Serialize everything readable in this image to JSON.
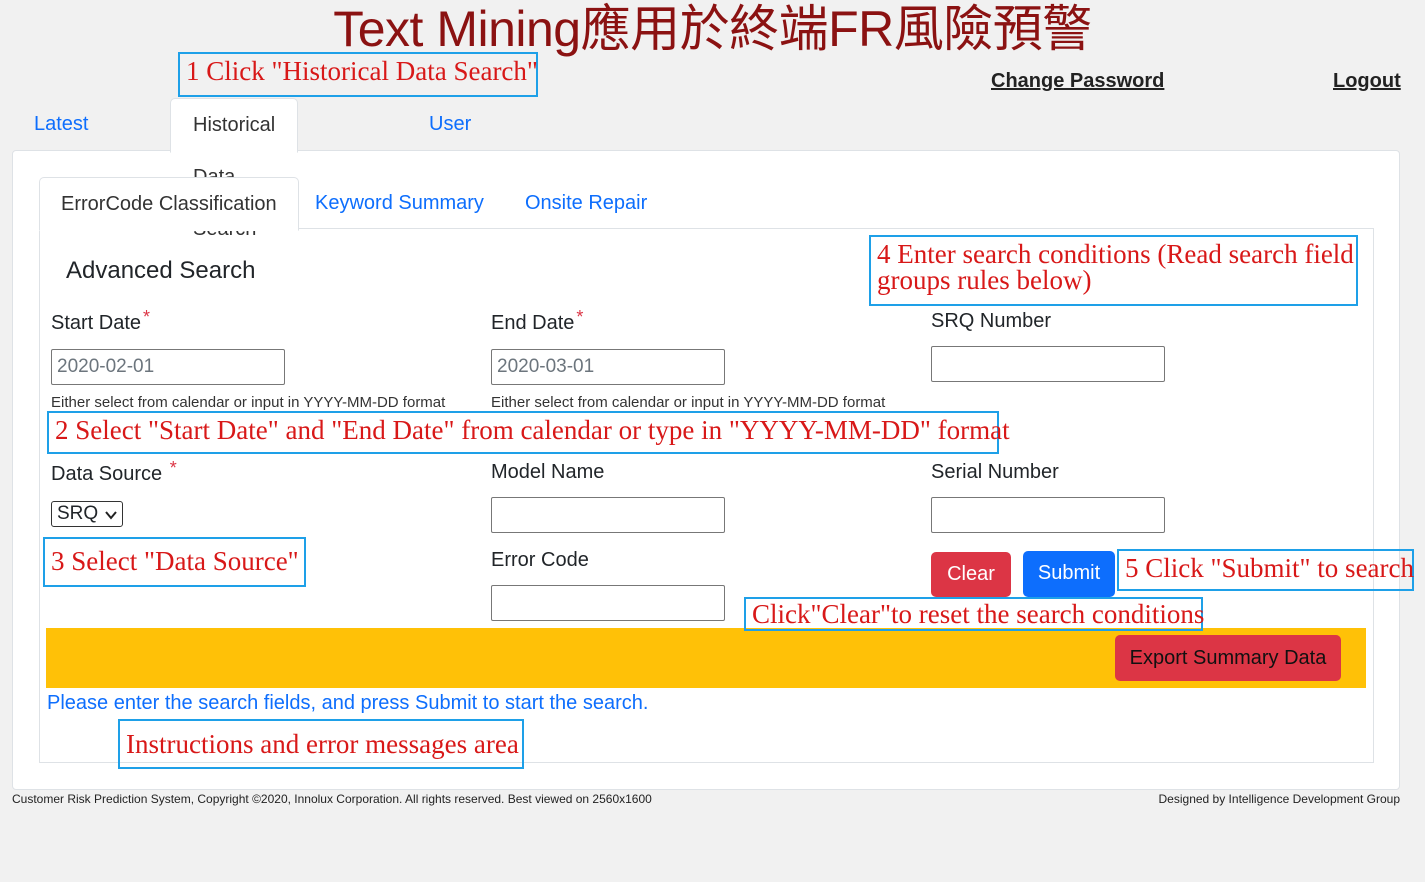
{
  "header": {
    "title": "Text Mining應用於終端FR風險預警",
    "change_password": "Change Password",
    "logout": "Logout"
  },
  "main_tabs": [
    {
      "label": "Latest Model",
      "active": false
    },
    {
      "label": "Historical Data Search",
      "active": true
    },
    {
      "label": "User Manual",
      "active": false
    }
  ],
  "sub_tabs": [
    {
      "label": "ErrorCode Classification",
      "active": true
    },
    {
      "label": "Keyword Summary",
      "active": false
    },
    {
      "label": "Onsite Repair",
      "active": false
    }
  ],
  "form": {
    "heading": "Advanced Search",
    "start_date": {
      "label": "Start Date",
      "value": "2020-02-01",
      "hint": "Either select from calendar or input in YYYY-MM-DD format"
    },
    "end_date": {
      "label": "End Date",
      "value": "2020-03-01",
      "hint": "Either select from calendar or input in YYYY-MM-DD format"
    },
    "srq_number": {
      "label": "SRQ Number",
      "value": ""
    },
    "data_source": {
      "label": "Data Source",
      "value": "SRQ"
    },
    "model_name": {
      "label": "Model Name",
      "value": ""
    },
    "serial_number": {
      "label": "Serial Number",
      "value": ""
    },
    "error_code": {
      "label": "Error Code",
      "value": ""
    },
    "required_mark": "*",
    "clear_label": "Clear",
    "submit_label": "Submit",
    "export_label": "Export Summary Data",
    "status_message": "Please enter the search fields, and press Submit to start the search."
  },
  "annotations": {
    "step1": "1 Click \"Historical Data Search\"",
    "step2": "2 Select \"Start Date\" and \"End Date\" from calendar or type in \"YYYY-MM-DD\" format",
    "step3": "3 Select \"Data Source\"",
    "step4_line1": "4 Enter search conditions (Read search field",
    "step4_line2": "groups rules below)",
    "step5": "5 Click \"Submit\" to search",
    "clear_note": "Click\"Clear\"to reset the search conditions",
    "messages_note": "Instructions and error messages area"
  },
  "footer": {
    "left": "Customer Risk Prediction System, Copyright ©2020, Innolux Corporation. All rights reserved. Best viewed on 2560x1600",
    "right": "Designed by Intelligence Development Group"
  },
  "colors": {
    "title": "#8b1212",
    "link_blue": "#0d6efd",
    "danger_red": "#dc3545",
    "warning_yellow": "#ffc107",
    "callout_border": "#1ea0e8",
    "callout_text": "#d81818"
  }
}
